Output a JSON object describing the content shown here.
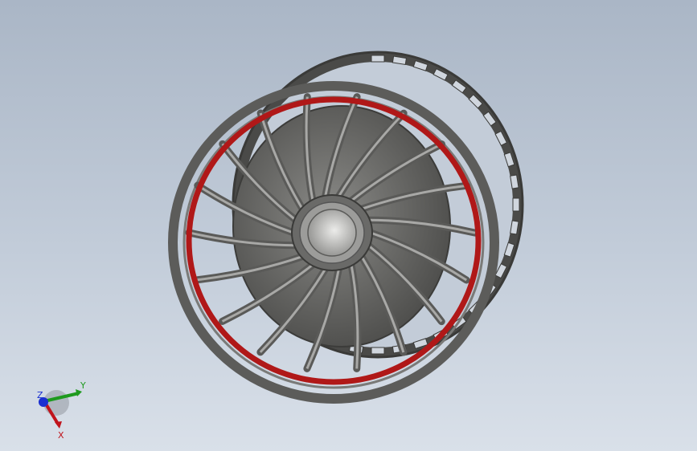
{
  "scene": {
    "model": "wheel-rim",
    "accent_color": "#b01818",
    "body_color": "#6e6e6c",
    "background_top": "#aab6c6",
    "background_bottom": "#d9e0e9"
  },
  "triad": {
    "x_label": "X",
    "y_label": "Y",
    "z_label": "Z",
    "x_color": "#c0141c",
    "y_color": "#1e9a1e",
    "z_color": "#1a2fd0"
  }
}
